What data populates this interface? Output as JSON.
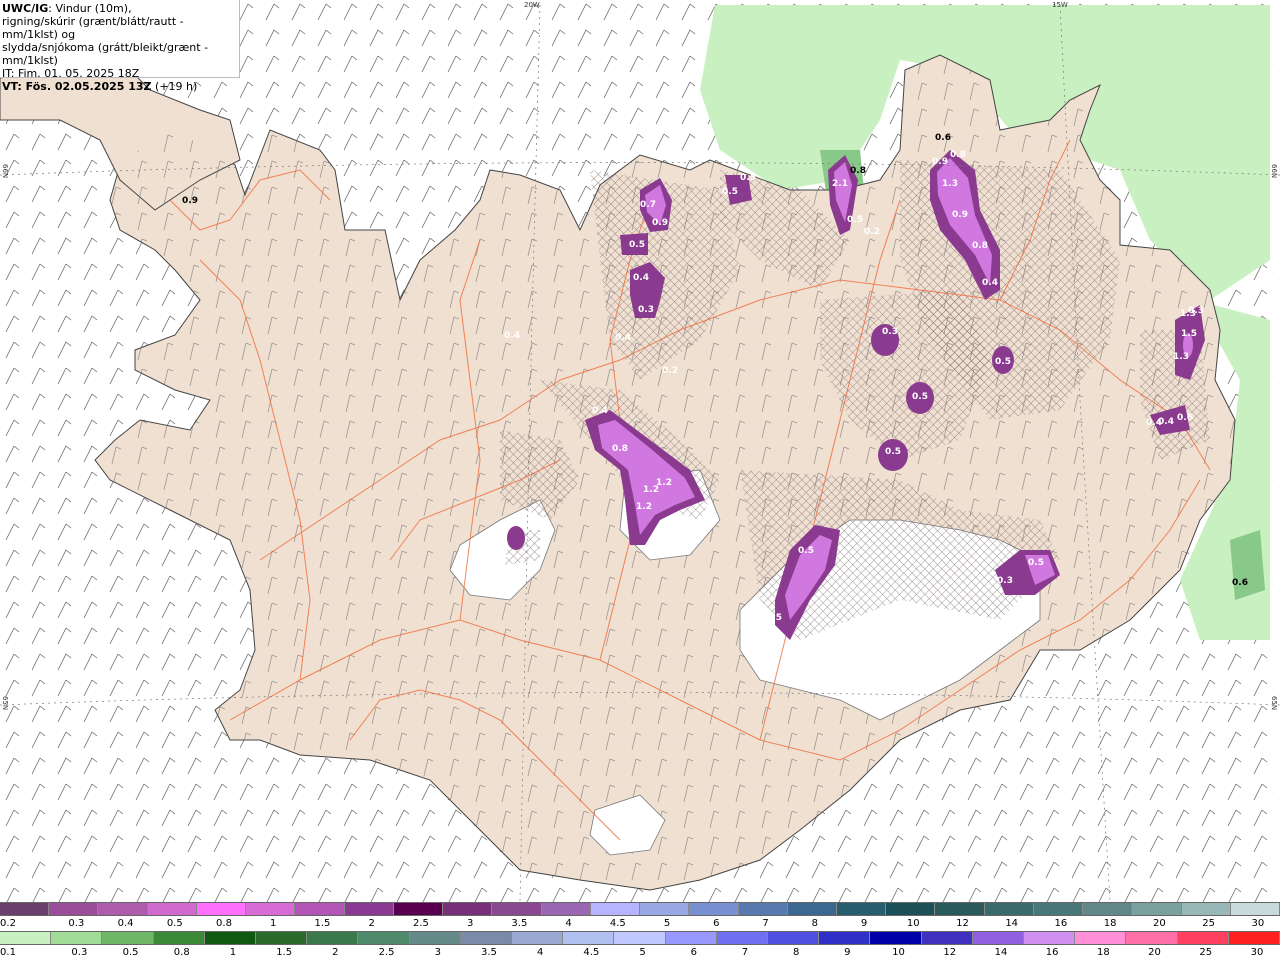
{
  "header": {
    "model": "UWC/IG",
    "desc1": ": Vindur (10m),",
    "desc2": "rigning/skúrir (grænt/blátt/rautt - mm/1klst) og",
    "desc3": "slydda/snjókoma (grátt/bleikt/grænt - mm/1klst)",
    "it": "IT: Fim. 01. 05. 2025 18Z",
    "vt": "VT: Fös. 02.05.2025 13Z",
    "vt_offset": " (+19 h)"
  },
  "grid_labels": {
    "lon_20w": "20W",
    "lon_15w": "15W",
    "lat_66n_left": "66N",
    "lat_66n_right": "66N",
    "lat_65n_left": "65N",
    "lat_65n_right": "65N"
  },
  "map_values": [
    "0.9",
    "0.7",
    "0.9",
    "0.5",
    "0.4",
    "0.3",
    "0.4",
    "0.4",
    "0.2",
    "0.8",
    "1.2",
    "1.2",
    "1.2",
    "0.4",
    "0.5",
    "0.5",
    "2.1",
    "0.8",
    "0.2",
    "0.3",
    "0.5",
    "0.5",
    "0.5",
    "0.6",
    "0.9",
    "0.8",
    "1.3",
    "0.9",
    "0.8",
    "0.4",
    "0.3",
    "0.5",
    "0.5",
    "1.5",
    "1.3",
    "0.3",
    "1.3",
    "0.4",
    "0.4",
    "0.6",
    "0.5",
    "0.5",
    "0.6"
  ],
  "snow_scale": [
    "0.2",
    "0.3",
    "0.4",
    "0.5",
    "0.8",
    "1",
    "1.5",
    "2",
    "2.5",
    "3",
    "3.5",
    "4",
    "4.5",
    "5",
    "6",
    "7",
    "8",
    "9",
    "10",
    "12",
    "14",
    "16",
    "18",
    "20",
    "25",
    "30"
  ],
  "rain_scale": [
    "0.1",
    "0.3",
    "0.5",
    "0.8",
    "1",
    "1.5",
    "2",
    "2.5",
    "3",
    "3.5",
    "4",
    "4.5",
    "5",
    "6",
    "7",
    "8",
    "9",
    "10",
    "12",
    "14",
    "16",
    "18",
    "20",
    "25",
    "30"
  ],
  "colors": {
    "land": "#f0e0d2",
    "glacier": "#ffffff",
    "roads": "#f07040",
    "snow_light": "#c068c8",
    "snow_strong": "#8a3a8f",
    "rain_light": "#c8f0c0",
    "rain_mid": "#88c888"
  }
}
